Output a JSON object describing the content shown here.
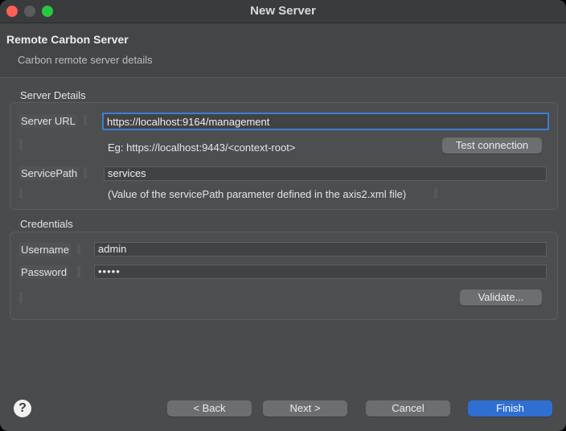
{
  "window": {
    "title": "New Server"
  },
  "header": {
    "title": "Remote Carbon Server",
    "subtitle": "Carbon remote server details"
  },
  "server_details": {
    "group_title": "Server Details",
    "server_url_label": "Server URL",
    "server_url_value": "https://localhost:9164/management",
    "example_text": "Eg: https://localhost:9443/<context-root>",
    "test_connection_label": "Test connection",
    "service_path_label": "ServicePath",
    "service_path_value": "services",
    "service_path_hint": "(Value of the servicePath parameter defined in the axis2.xml file)"
  },
  "credentials": {
    "group_title": "Credentials",
    "username_label": "Username",
    "username_value": "admin",
    "password_label": "Password",
    "password_value": "•••••",
    "validate_label": "Validate..."
  },
  "footer": {
    "help_glyph": "?",
    "back_label": "< Back",
    "next_label": "Next >",
    "cancel_label": "Cancel",
    "finish_label": "Finish"
  },
  "colors": {
    "accent": "#3d7fce",
    "primary_button": "#2f6fd1"
  }
}
